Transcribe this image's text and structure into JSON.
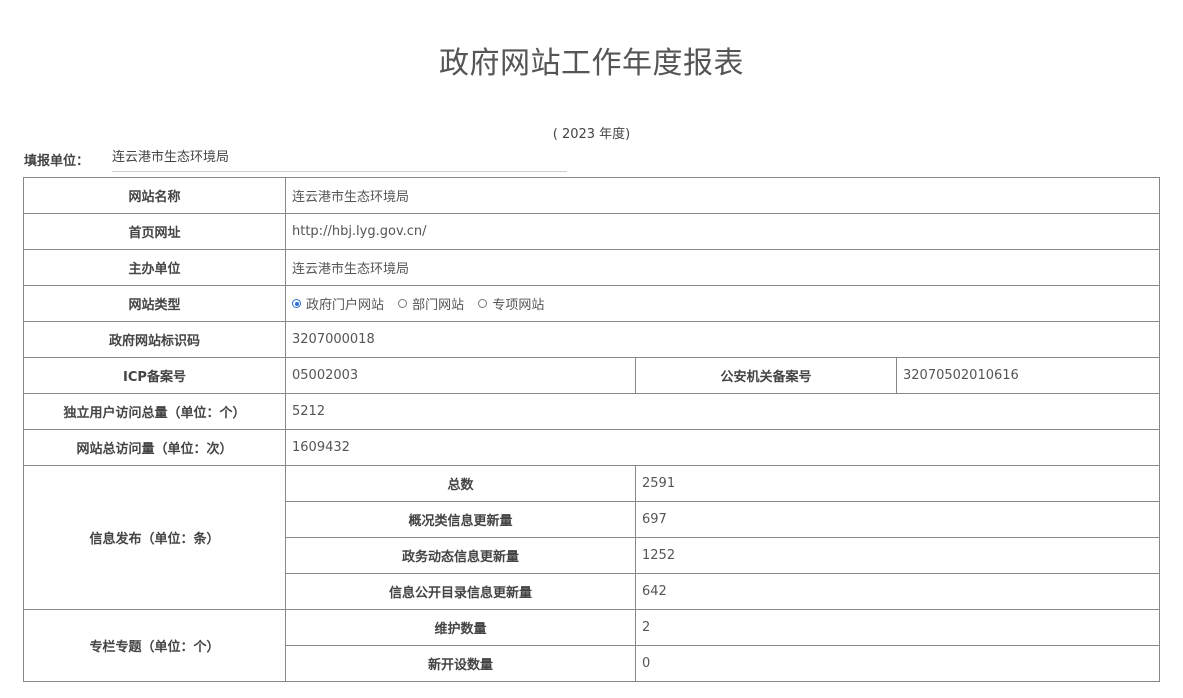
{
  "title": "政府网站工作年度报表",
  "year_line": "( 2023 年度)",
  "fill_unit": {
    "label": "填报单位：",
    "value": "连云港市生态环境局"
  },
  "rows": {
    "site_name": {
      "label": "网站名称",
      "value": "连云港市生态环境局"
    },
    "homepage": {
      "label": "首页网址",
      "value": "http://hbj.lyg.gov.cn/"
    },
    "sponsor": {
      "label": "主办单位",
      "value": "连云港市生态环境局"
    },
    "site_type": {
      "label": "网站类型",
      "options": [
        "政府门户网站",
        "部门网站",
        "专项网站"
      ],
      "selected": "政府门户网站"
    },
    "site_id": {
      "label": "政府网站标识码",
      "value": "3207000018"
    },
    "icp": {
      "label": "ICP备案号",
      "value": "05002003",
      "police_label": "公安机关备案号",
      "police_value": "32070502010616"
    },
    "unique_visitors": {
      "label": "独立用户访问总量（单位：个）",
      "value": "5212"
    },
    "total_visits": {
      "label": "网站总访问量（单位：次）",
      "value": "1609432"
    },
    "info_publish": {
      "label": "信息发布（单位：条）",
      "items": [
        {
          "label": "总数",
          "value": "2591"
        },
        {
          "label": "概况类信息更新量",
          "value": "697"
        },
        {
          "label": "政务动态信息更新量",
          "value": "1252"
        },
        {
          "label": "信息公开目录信息更新量",
          "value": "642"
        }
      ]
    },
    "columns": {
      "label": "专栏专题（单位：个）",
      "items": [
        {
          "label": "维护数量",
          "value": "2"
        },
        {
          "label": "新开设数量",
          "value": "0"
        }
      ]
    }
  }
}
